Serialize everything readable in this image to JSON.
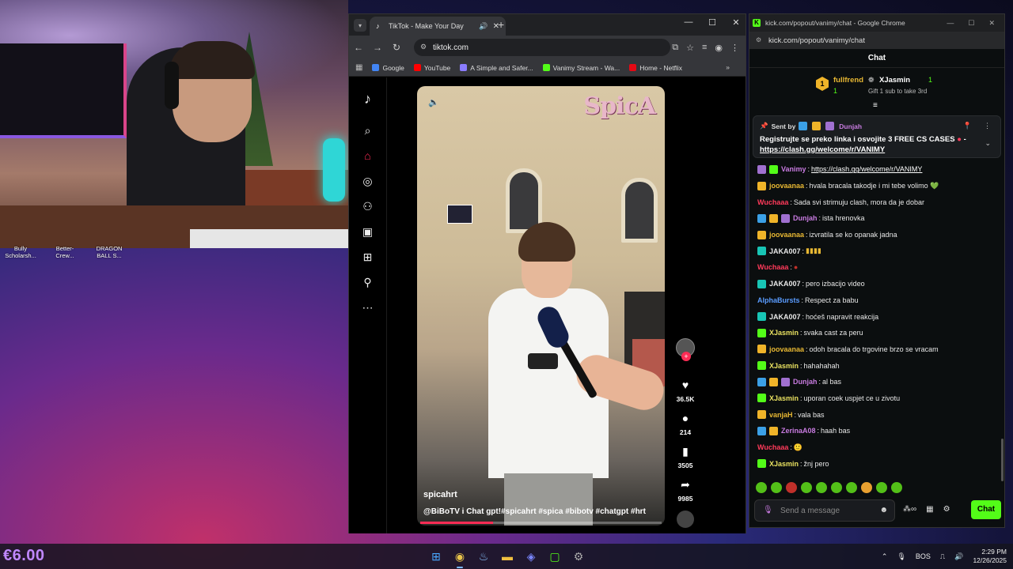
{
  "desktop": {
    "icons": [
      {
        "label": "Bully Scholarsh..."
      },
      {
        "label": "Better-Crew..."
      },
      {
        "label": "DRAGON BALL S..."
      }
    ]
  },
  "tiktok_browser": {
    "tab_title": "TikTok - Make Your Day",
    "url": "tiktok.com",
    "bookmarks": [
      {
        "label": "Google",
        "color": "#4285f4"
      },
      {
        "label": "YouTube",
        "color": "#ff0000"
      },
      {
        "label": "A Simple and Safer...",
        "color": "#8a7cff"
      },
      {
        "label": "Vanimy Stream - Wa...",
        "color": "#53fc18"
      },
      {
        "label": "Home - Netflix",
        "color": "#e50914"
      }
    ],
    "video": {
      "brand": "SpicA",
      "author": "spicahrt",
      "caption": "@BiBoTV i Chat gpt!#spicahrt #spica #bibotv #chatgpt #hrt",
      "progress": 0.3
    },
    "actions": {
      "likes": "36.5K",
      "comments": "214",
      "saves": "3505",
      "shares": "9985"
    }
  },
  "kick_chat": {
    "window_title": "kick.com/popout/vanimy/chat - Google Chrome",
    "url": "kick.com/popout/vanimy/chat",
    "header": "Chat",
    "leaderboard": {
      "first_rank": "1",
      "first_name": "fullfrend",
      "first_count": "1",
      "second_name": "XJasmin",
      "second_count": "1",
      "gift_text": "Gift 1 sub to take 3rd"
    },
    "pinned": {
      "sent_by": "Sent by",
      "sender": "Dunjah",
      "text": "Registrujte se preko linka i osvojite 3 FREE CS CASES",
      "link": "https://clash.gg/welcome/r/VANIMY"
    },
    "messages": [
      {
        "user": "Vanimy",
        "color": "#c87be0",
        "text": "https://clash.gg/welcome/r/VANIMY",
        "link": true
      },
      {
        "user": "joovaanaa",
        "color": "#e8b833",
        "text": "hvala bracala takodje i mi tebe volimo 💚"
      },
      {
        "user": "Wuchaaa",
        "color": "#ff3a5a",
        "text": "Sada svi strimuju clash, mora da je dobar"
      },
      {
        "user": "Dunjah",
        "color": "#c87be0",
        "text": "ista hrenovka"
      },
      {
        "user": "joovaanaa",
        "color": "#e8b833",
        "text": "izvratila se ko opanak jadna"
      },
      {
        "user": "JAKA007",
        "color": "#e8e8e8",
        "text": "▮▮▮▮"
      },
      {
        "user": "Wuchaaa",
        "color": "#ff3a5a",
        "text": "●"
      },
      {
        "user": "JAKA007",
        "color": "#e8e8e8",
        "text": "pero izbacijo video"
      },
      {
        "user": "AlphaBursts",
        "color": "#5a9cff",
        "text": "Respect za babu"
      },
      {
        "user": "JAKA007",
        "color": "#e8e8e8",
        "text": "hoćeš napravit reakcija"
      },
      {
        "user": "XJasmin",
        "color": "#e8e060",
        "text": "svaka cast za peru"
      },
      {
        "user": "joovaanaa",
        "color": "#e8b833",
        "text": "odoh bracala do trgovine brzo se vracam"
      },
      {
        "user": "XJasmin",
        "color": "#e8e060",
        "text": "hahahahah"
      },
      {
        "user": "Dunjah",
        "color": "#c87be0",
        "text": "al bas"
      },
      {
        "user": "XJasmin",
        "color": "#e8e060",
        "text": "uporan coek uspjet ce u zivotu"
      },
      {
        "user": "vanjaH",
        "color": "#e8b833",
        "text": "vala bas"
      },
      {
        "user": "ZerinaA08",
        "color": "#c87be0",
        "text": "haah bas"
      },
      {
        "user": "Wuchaaa",
        "color": "#ff3a5a",
        "text": "🙂"
      },
      {
        "user": "XJasmin",
        "color": "#e8e060",
        "text": "žnj pero"
      }
    ],
    "input_placeholder": "Send a message",
    "send_label": "Chat"
  },
  "taskbar": {
    "money": "€6.00",
    "language": "BOS",
    "time": "2:29 PM",
    "date": "12/26/2025"
  }
}
